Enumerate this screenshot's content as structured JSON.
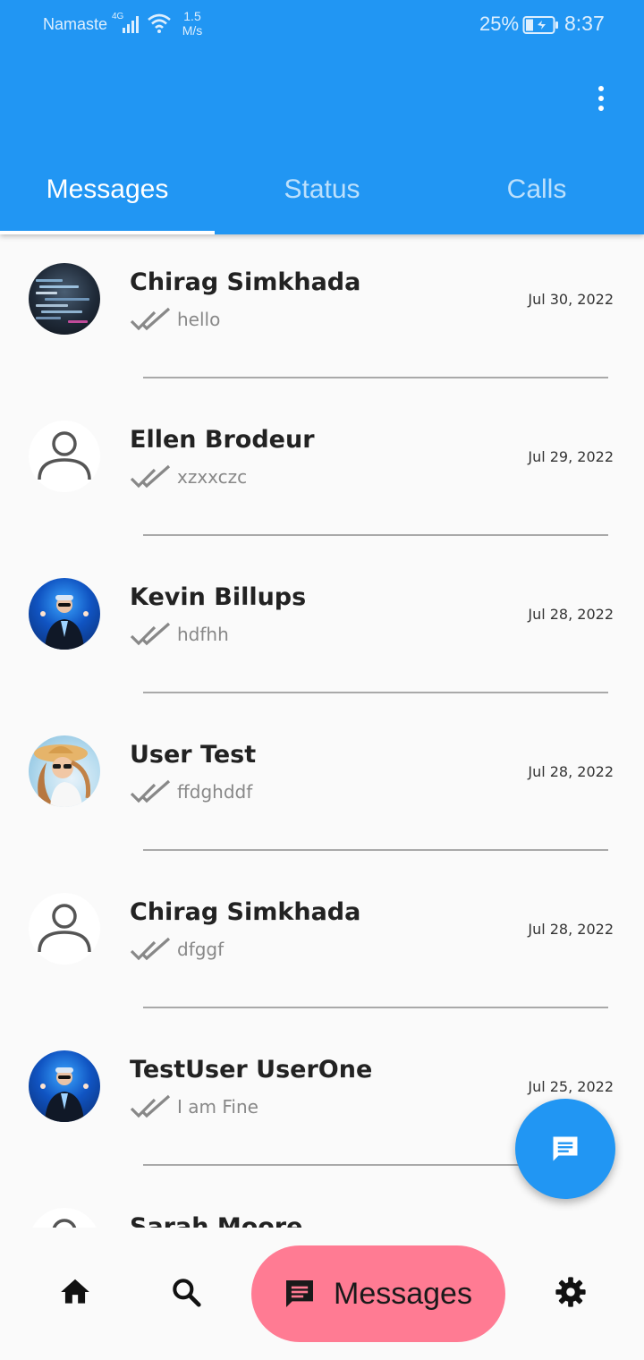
{
  "status_bar": {
    "carrier": "Namaste",
    "network": "4G",
    "speed_value": "1.5",
    "speed_unit": "M/s",
    "battery_percent": "25%",
    "time": "8:37"
  },
  "header": {
    "color": "#2196f3",
    "menu_icon": "more-vert-icon",
    "tabs": [
      {
        "label": "Messages",
        "active": true
      },
      {
        "label": "Status",
        "active": false
      },
      {
        "label": "Calls",
        "active": false
      }
    ]
  },
  "conversations": [
    {
      "name": "Chirag Simkhada",
      "last_message": "hello",
      "date": "Jul 30, 2022",
      "avatar": "code-screen-photo"
    },
    {
      "name": "Ellen Brodeur",
      "last_message": "xzxxczc",
      "date": "Jul 29, 2022",
      "avatar": "default-person-icon"
    },
    {
      "name": "Kevin Billups",
      "last_message": "hdfhh",
      "date": "Jul 28, 2022",
      "avatar": "neon-person-photo"
    },
    {
      "name": "User Test",
      "last_message": "ffdghddf",
      "date": "Jul 28, 2022",
      "avatar": "sunhat-woman-photo"
    },
    {
      "name": "Chirag Simkhada",
      "last_message": "dfggf",
      "date": "Jul 28, 2022",
      "avatar": "default-person-icon"
    },
    {
      "name": "TestUser UserOne",
      "last_message": "I am Fine",
      "date": "Jul 25, 2022",
      "avatar": "neon-person-photo"
    },
    {
      "name": "Sarah Moore",
      "last_message": "",
      "date": "",
      "avatar": "default-person-icon"
    }
  ],
  "fab": {
    "icon": "new-message-icon",
    "color": "#2196f3"
  },
  "bottom_nav": {
    "items": [
      {
        "icon": "home-icon"
      },
      {
        "icon": "search-icon"
      },
      {
        "icon": "message-icon",
        "label": "Messages",
        "active": true
      },
      {
        "icon": "settings-icon"
      }
    ],
    "active_color": "#ff7b93"
  }
}
